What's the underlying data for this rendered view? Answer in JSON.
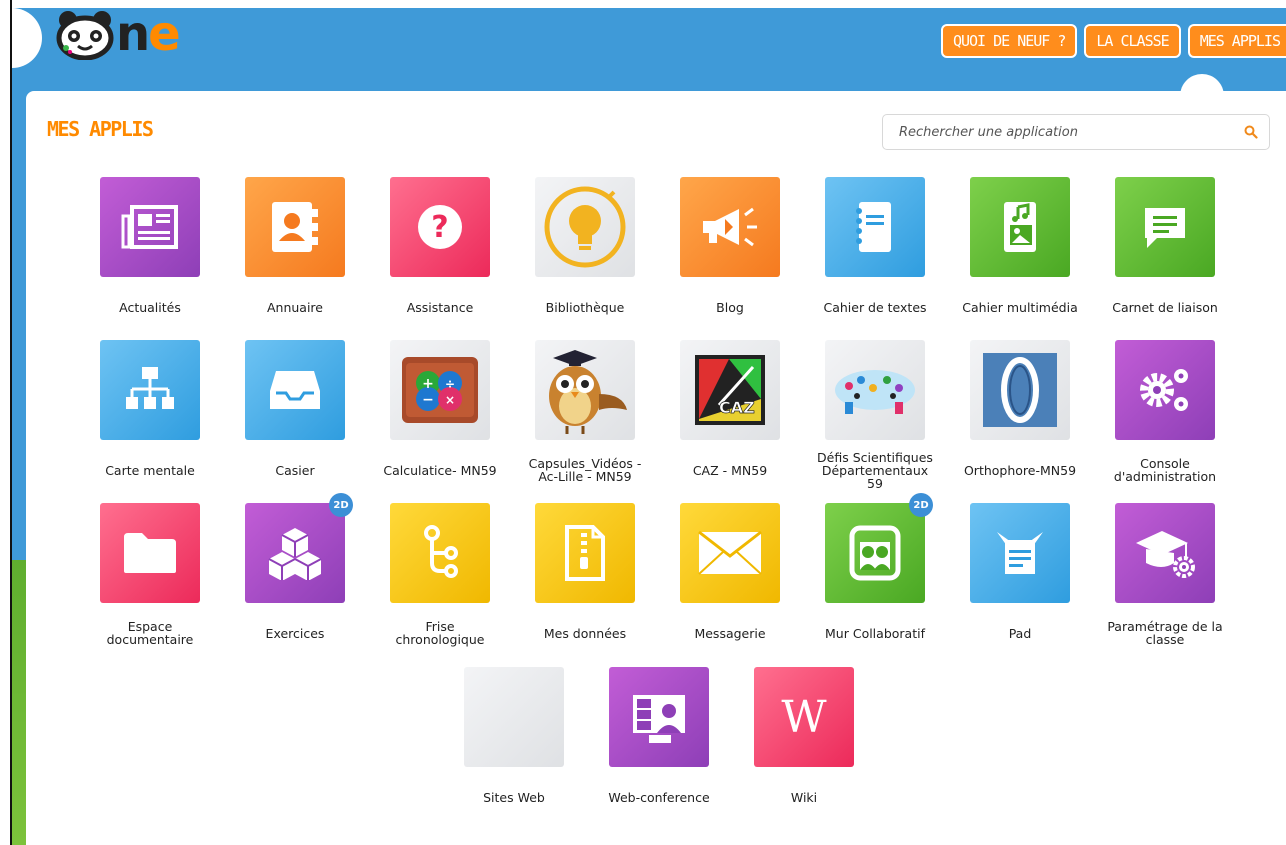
{
  "header": {
    "logo_text_a": "o",
    "logo_text_n": "n",
    "logo_text_e": "e",
    "nav": [
      "QUOI DE NEUF ?",
      "LA CLASSE",
      "MES APPLIS"
    ]
  },
  "main": {
    "title": "MES APPLIS",
    "search_placeholder": "Rechercher une application"
  },
  "apps": [
    {
      "label": "Actualités",
      "color": "purple",
      "icon": "newspaper-icon"
    },
    {
      "label": "Annuaire",
      "color": "orange",
      "icon": "contact-book-icon"
    },
    {
      "label": "Assistance",
      "color": "pink",
      "icon": "question-icon"
    },
    {
      "label": "Bibliothèque",
      "color": "grey",
      "icon": "lightbulb-icon"
    },
    {
      "label": "Blog",
      "color": "orange",
      "icon": "megaphone-icon"
    },
    {
      "label": "Cahier de textes",
      "color": "blue",
      "icon": "notebook-icon"
    },
    {
      "label": "Cahier multimédia",
      "color": "green",
      "icon": "media-notebook-icon"
    },
    {
      "label": "Carnet de liaison",
      "color": "green",
      "icon": "message-icon"
    },
    {
      "label": "Carte mentale",
      "color": "blue",
      "icon": "mindmap-icon"
    },
    {
      "label": "Casier",
      "color": "blue",
      "icon": "inbox-tray-icon"
    },
    {
      "label": "Calculatice- MN59",
      "color": "grey",
      "icon": "calculatice-brain-icon"
    },
    {
      "label": "Capsules_Vidéos -\nAc-Lille - MN59",
      "color": "grey",
      "icon": "owl-icon"
    },
    {
      "label": "CAZ - MN59",
      "color": "grey",
      "icon": "caz-icon"
    },
    {
      "label": "Défis Scientifiques\nDépartementaux\n59",
      "color": "grey",
      "icon": "science-cloud-icon"
    },
    {
      "label": "Orthophore-MN59",
      "color": "grey",
      "icon": "orthophore-icon"
    },
    {
      "label": "Console\nd'administration",
      "color": "purple",
      "icon": "gears-icon"
    },
    {
      "label": "Espace\ndocumentaire",
      "color": "pink",
      "icon": "folder-icon"
    },
    {
      "label": "Exercices",
      "color": "purple",
      "icon": "cubes-icon",
      "badge": "2D"
    },
    {
      "label": "Frise\nchronologique",
      "color": "yellow",
      "icon": "timeline-icon"
    },
    {
      "label": "Mes données",
      "color": "yellow",
      "icon": "zip-file-icon"
    },
    {
      "label": "Messagerie",
      "color": "yellow",
      "icon": "envelope-icon"
    },
    {
      "label": "Mur Collaboratif",
      "color": "green",
      "icon": "collab-wall-icon",
      "badge": "2D"
    },
    {
      "label": "Pad",
      "color": "blue",
      "icon": "pad-icon"
    },
    {
      "label": "Paramétrage de la\nclasse",
      "color": "purple",
      "icon": "graduation-cap-gear-icon"
    },
    {
      "label": "Sites Web",
      "color": "grey",
      "icon": "blank-icon"
    },
    {
      "label": "Web-conference",
      "color": "purple",
      "icon": "webconference-icon"
    },
    {
      "label": "Wiki",
      "color": "pink",
      "icon": "wikipedia-icon"
    }
  ]
}
